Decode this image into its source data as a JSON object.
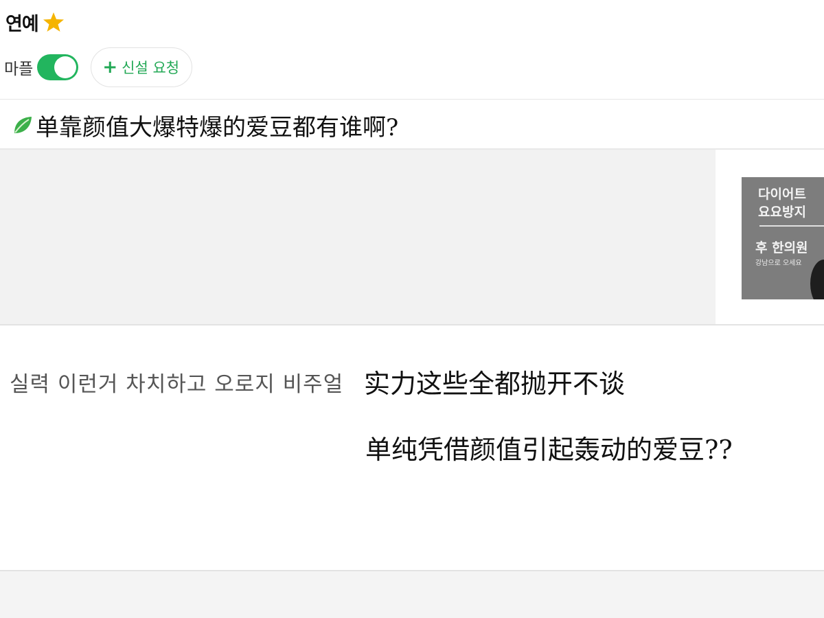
{
  "header": {
    "category_title": "연예",
    "star_icon": "star-icon",
    "star_color": "#f5b400"
  },
  "controls": {
    "mapeul_label": "마플",
    "toggle_on": true,
    "toggle_color": "#22b55e",
    "request_button_label": "신설 요청",
    "request_button_icon": "plus-icon"
  },
  "post": {
    "leaf_icon": "leaf-icon",
    "title": "单靠颜值大爆特爆的爱豆都有谁啊?"
  },
  "ad": {
    "line1": "다이어트",
    "line2": "요요방지",
    "line3": "후 한의원",
    "line4": "강남으로 오세요"
  },
  "body": {
    "korean_text": "실력 이런거 차치하고 오로지 비주얼",
    "translation_line1": "实力这些全都抛开不谈",
    "translation_line2": "单纯凭借颜值引起轰动的爱豆??"
  }
}
